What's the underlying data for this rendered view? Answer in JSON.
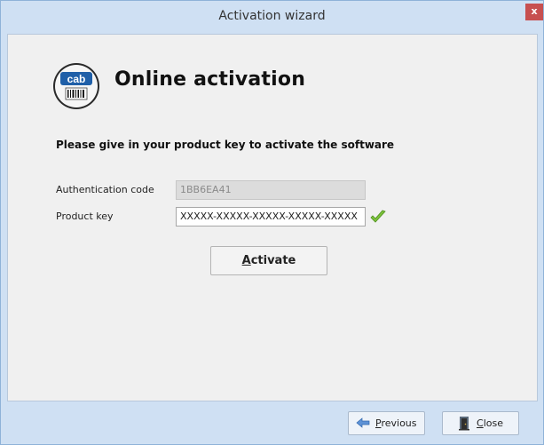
{
  "window": {
    "title": "Activation wizard",
    "close_label": "x"
  },
  "logo": {
    "brand": "cab"
  },
  "page": {
    "heading": "Online activation",
    "instruction": "Please give in your product key to activate the software"
  },
  "form": {
    "auth_code_label": "Authentication code",
    "auth_code_value": "1BB6EA41",
    "product_key_label": "Product key",
    "product_key_value": "XXXXX-XXXXX-XXXXX-XXXXX-XXXXX",
    "product_key_valid": true
  },
  "buttons": {
    "activate_first": "A",
    "activate_rest": "ctivate",
    "previous_first": "P",
    "previous_rest": "revious",
    "close_first": "C",
    "close_rest": "lose"
  },
  "colors": {
    "accent": "#cfe0f3",
    "close_button": "#c75050",
    "valid_check": "#7cc23a"
  },
  "icons": {
    "logo": "cab-logo-icon",
    "check": "checkmark-icon",
    "previous": "back-arrow-icon",
    "close": "exit-door-icon"
  }
}
